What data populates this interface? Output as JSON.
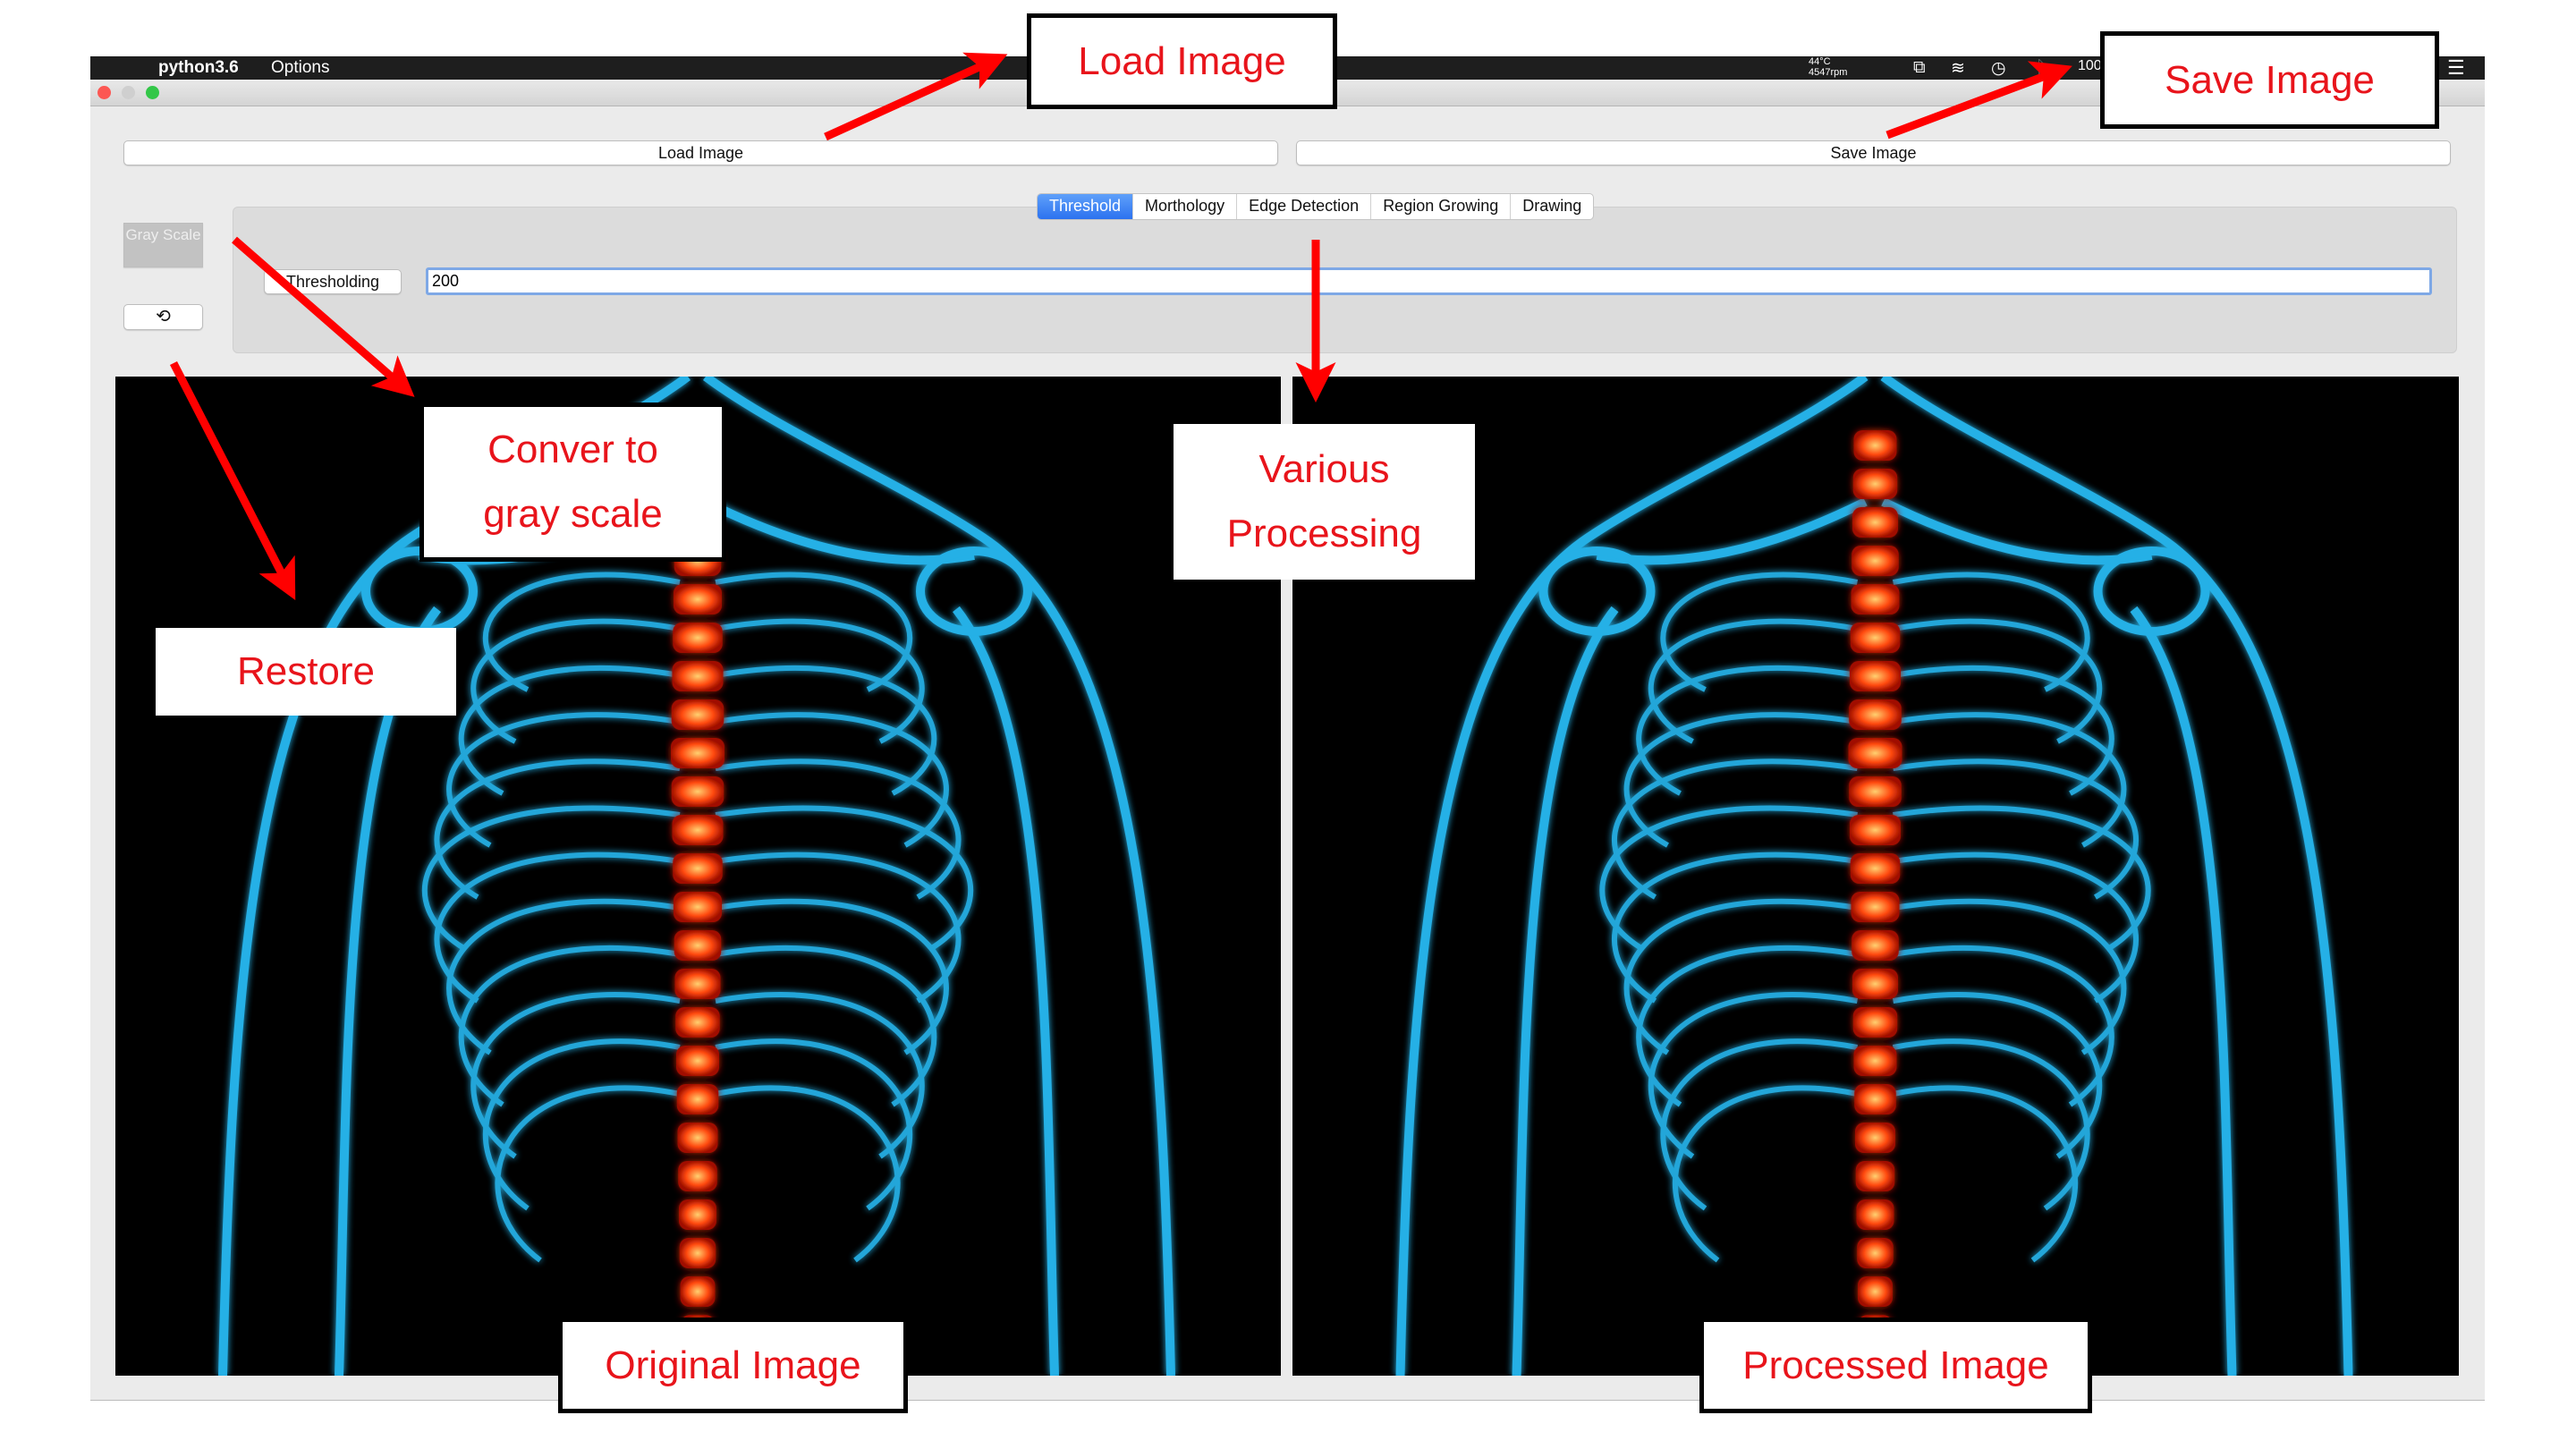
{
  "menubar": {
    "app_name": "python3.6",
    "menu_options": "Options",
    "temperature": "44°C",
    "fan_speed": "4547rpm",
    "battery": "100"
  },
  "toolbar": {
    "load_label": "Load Image",
    "save_label": "Save Image"
  },
  "sidebar": {
    "gray_scale_label": "Gray Scale",
    "restore_icon": "restore-icon"
  },
  "tabs": [
    {
      "label": "Threshold",
      "active": true
    },
    {
      "label": "Morthology",
      "active": false
    },
    {
      "label": "Edge Detection",
      "active": false
    },
    {
      "label": "Region Growing",
      "active": false
    },
    {
      "label": "Drawing",
      "active": false
    }
  ],
  "threshold": {
    "button_label": "Thresholding",
    "value": "200"
  },
  "annotations": {
    "load": "Load Image",
    "save": "Save Image",
    "gray": "Conver to gray scale",
    "various": "Various Processing",
    "restore": "Restore",
    "original": "Original Image",
    "processed": "Processed Image"
  },
  "colors": {
    "accent": "#2c72ef",
    "annotation": "#e8141b",
    "bone": "#29c4ff",
    "spine": "#ff4a10"
  }
}
